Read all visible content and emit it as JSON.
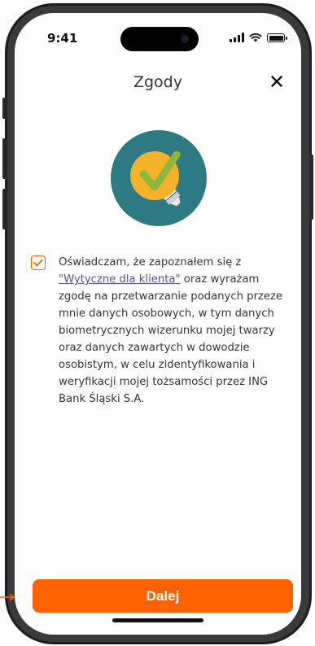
{
  "status_bar": {
    "time": "9:41"
  },
  "header": {
    "title": "Zgody"
  },
  "consent": {
    "checked": true,
    "text_before": "Oświadczam, że zapoznałem się z ",
    "link_text": "\"Wytyczne dla klienta\"",
    "text_after": " oraz wyrażam zgodę na przetwarzanie podanych przeze mnie danych osobowych, w tym danych biometrycznych wizerunku mojej twarzy oraz danych zawartych w dowodzie osobistym, w celu zidentyfikowania i weryfikacji mojej tożsamości przez ING Bank Śląski S.A."
  },
  "footer": {
    "next_label": "Dalej"
  },
  "icons": {
    "close": "close-icon",
    "illustration": "lightbulb-check-icon",
    "checkbox": "checkmark-icon"
  },
  "colors": {
    "accent": "#ff6200",
    "link": "#525199",
    "illustration_circle": "#2d7a82",
    "bulb": "#f4b32a",
    "check": "#8db63c"
  }
}
